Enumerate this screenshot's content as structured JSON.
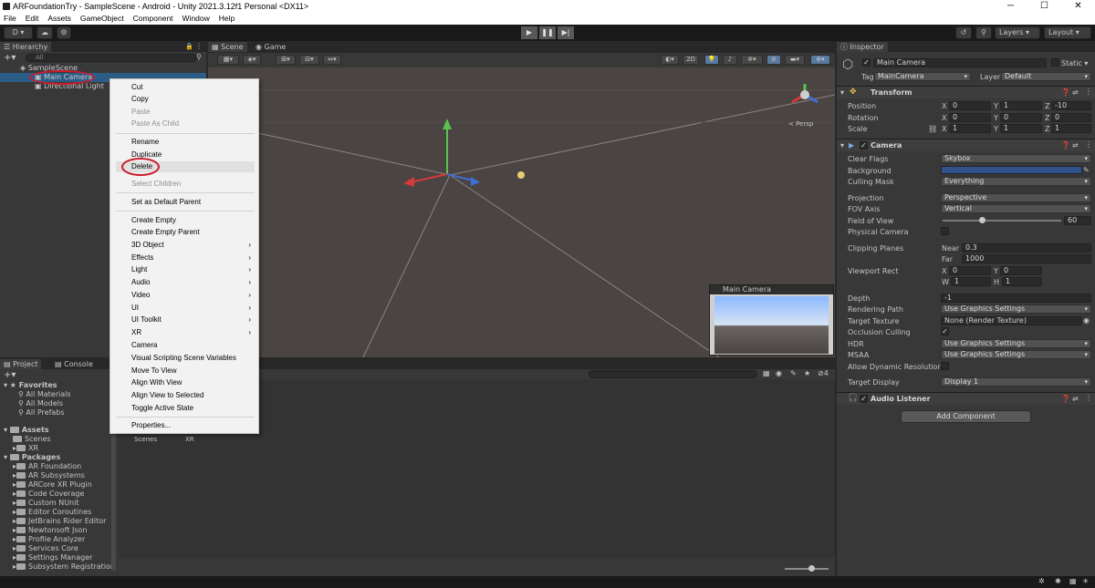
{
  "window": {
    "title": "ARFoundationTry - SampleScene - Android - Unity 2021.3.12f1 Personal <DX11>",
    "controls": [
      "─",
      "☐",
      "✕"
    ]
  },
  "menubar": [
    "File",
    "Edit",
    "Assets",
    "GameObject",
    "Component",
    "Window",
    "Help"
  ],
  "toolbar": {
    "account": "D ▾",
    "layers": "Layers",
    "layout": "Layout"
  },
  "hierarchy": {
    "tab": "Hierarchy",
    "search_placeholder": "All",
    "scene": "SampleScene",
    "items": [
      "Main Camera",
      "Directional Light"
    ]
  },
  "scene_tabs": [
    "Scene",
    "Game"
  ],
  "scene": {
    "toolbar_2d": "2D",
    "persp": "< Persp",
    "camera_preview_title": "Main Camera"
  },
  "context_menu": {
    "items": [
      {
        "label": "Cut",
        "disabled": false
      },
      {
        "label": "Copy",
        "disabled": false
      },
      {
        "label": "Paste",
        "disabled": true
      },
      {
        "label": "Paste As Child",
        "disabled": true
      },
      {
        "label": "Rename",
        "disabled": false
      },
      {
        "label": "Duplicate",
        "disabled": false
      },
      {
        "label": "Delete",
        "disabled": false
      },
      {
        "label": "Select Children",
        "disabled": true
      },
      {
        "label": "Set as Default Parent",
        "disabled": false
      },
      {
        "label": "Create Empty",
        "disabled": false
      },
      {
        "label": "Create Empty Parent",
        "disabled": false
      },
      {
        "label": "3D Object",
        "disabled": false
      },
      {
        "label": "Effects",
        "disabled": false
      },
      {
        "label": "Light",
        "disabled": false
      },
      {
        "label": "Audio",
        "disabled": false
      },
      {
        "label": "Video",
        "disabled": false
      },
      {
        "label": "UI",
        "disabled": false
      },
      {
        "label": "UI Toolkit",
        "disabled": false
      },
      {
        "label": "XR",
        "disabled": false
      },
      {
        "label": "Camera",
        "disabled": false
      },
      {
        "label": "Visual Scripting Scene Variables",
        "disabled": false
      },
      {
        "label": "Move To View",
        "disabled": false
      },
      {
        "label": "Align With View",
        "disabled": false
      },
      {
        "label": "Align View to Selected",
        "disabled": false
      },
      {
        "label": "Toggle Active State",
        "disabled": false
      },
      {
        "label": "Properties...",
        "disabled": false
      }
    ]
  },
  "project": {
    "tabs": [
      "Project",
      "Console"
    ],
    "favorites": "Favorites",
    "favorite_items": [
      "All Materials",
      "All Models",
      "All Prefabs"
    ],
    "assets": "Assets",
    "asset_items": [
      "Scenes",
      "XR"
    ],
    "packages": "Packages",
    "package_items": [
      "AR Foundation",
      "AR Subsystems",
      "ARCore XR Plugin",
      "Code Coverage",
      "Custom NUnit",
      "Editor Coroutines",
      "JetBrains Rider Editor",
      "Newtonsoft Json",
      "Profile Analyzer",
      "Services Core",
      "Settings Manager",
      "Subsystem Registration"
    ],
    "grid_items": [
      "Scenes",
      "XR"
    ],
    "hidden_count": "4"
  },
  "inspector": {
    "tab": "Inspector",
    "object_name": "Main Camera",
    "static_label": "Static",
    "tag_label": "Tag",
    "tag_value": "MainCamera",
    "layer_label": "Layer",
    "layer_value": "Default",
    "transform": {
      "title": "Transform",
      "position_label": "Position",
      "rotation_label": "Rotation",
      "scale_label": "Scale",
      "position": [
        "0",
        "1",
        "-10"
      ],
      "rotation": [
        "0",
        "0",
        "0"
      ],
      "scale": [
        "1",
        "1",
        "1"
      ]
    },
    "camera": {
      "title": "Camera",
      "clear_flags_label": "Clear Flags",
      "clear_flags": "Skybox",
      "background_label": "Background",
      "background_color": "#31528c",
      "culling_mask_label": "Culling Mask",
      "culling_mask": "Everything",
      "projection_label": "Projection",
      "projection": "Perspective",
      "fov_axis_label": "FOV Axis",
      "fov_axis": "Vertical",
      "fov_label": "Field of View",
      "fov": "60",
      "physical_label": "Physical Camera",
      "clipping_label": "Clipping Planes",
      "near_label": "Near",
      "near": "0.3",
      "far_label": "Far",
      "far": "1000",
      "viewport_label": "Viewport Rect",
      "vp_x": "0",
      "vp_y": "0",
      "vp_w": "1",
      "vp_h": "1",
      "depth_label": "Depth",
      "depth": "-1",
      "rendering_path_label": "Rendering Path",
      "rendering_path": "Use Graphics Settings",
      "target_texture_label": "Target Texture",
      "target_texture": "None (Render Texture)",
      "occlusion_label": "Occlusion Culling",
      "hdr_label": "HDR",
      "hdr": "Use Graphics Settings",
      "msaa_label": "MSAA",
      "msaa": "Use Graphics Settings",
      "dyn_res_label": "Allow Dynamic Resolution",
      "target_display_label": "Target Display",
      "target_display": "Display 1"
    },
    "audio_listener": "Audio Listener",
    "add_component": "Add Component"
  }
}
